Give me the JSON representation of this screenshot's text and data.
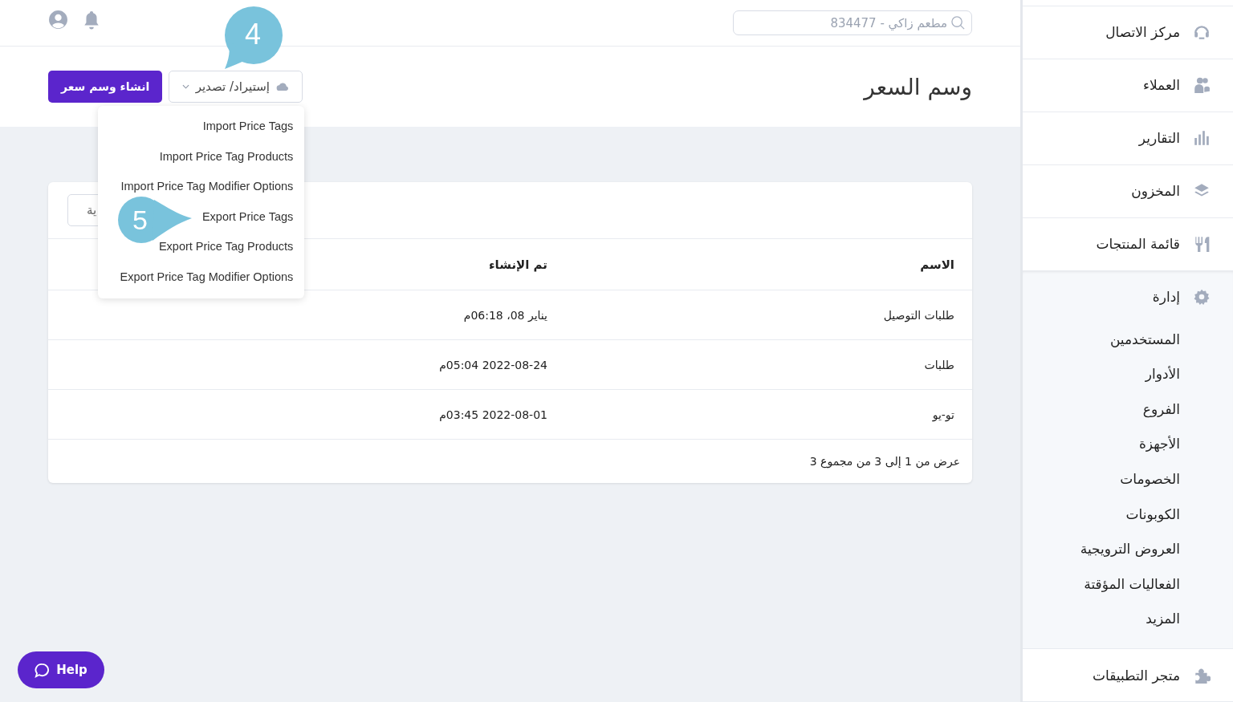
{
  "topbar": {
    "search": {
      "placeholder": "مطعم زاكي - 834477"
    }
  },
  "header": {
    "title": "وسم السعر",
    "import_export_button": "إستيراد/ تصدير",
    "create_button": "انشاء وسم سعر"
  },
  "dropdown": {
    "items": [
      "Import Price Tags",
      "Import Price Tag Products",
      "Import Price Tag Modifier Options",
      "Export Price Tags",
      "Export Price Tag Products",
      "Export Price Tag Modifier Options"
    ]
  },
  "callouts": [
    "4",
    "5"
  ],
  "card": {
    "toolbar_button": "ية",
    "table": {
      "columns": [
        "الاسم",
        "تم الإنشاء"
      ],
      "rows": [
        [
          "طلبات التوصيل",
          "يناير 08، 06:18م"
        ],
        [
          "طلبات",
          "2022-08-24 05:04م"
        ],
        [
          "تو-يو",
          "2022-08-01 03:45م"
        ]
      ]
    },
    "footer": "عرض من 1 إلى 3 من مجموع 3"
  },
  "help_button": "Help",
  "sidebar": {
    "items": [
      {
        "label": "مركز الاتصال",
        "expanded": false
      },
      {
        "label": "العملاء",
        "expanded": false
      },
      {
        "label": "التقارير",
        "expanded": false
      },
      {
        "label": "المخزون",
        "expanded": false
      },
      {
        "label": "قائمة المنتجات",
        "expanded": false
      },
      {
        "label": "إدارة",
        "expanded": true,
        "children": [
          "المستخدمين",
          "الأدوار",
          "الفروع",
          "الأجهزة",
          "الخصومات",
          "الكوبونات",
          "العروض الترويجية",
          "الفعاليات المؤقتة",
          "المزيد"
        ]
      },
      {
        "label": "متجر التطبيقات",
        "expanded": false
      }
    ]
  }
}
